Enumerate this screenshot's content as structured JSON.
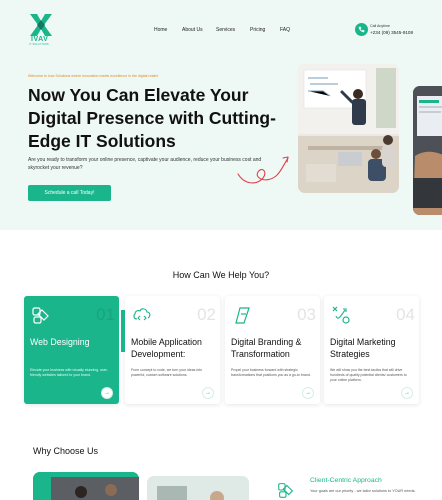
{
  "brand": {
    "name": "IVAV",
    "tagline": "IT SOLUTIONS",
    "accent": "#1bb58c",
    "hero_bg": "#eef8f5",
    "welcome_color": "#e08a1e"
  },
  "nav": {
    "items": [
      "Home",
      "About Us",
      "Services",
      "Pricing",
      "FAQ"
    ]
  },
  "contact": {
    "label": "Call Anytime",
    "phone": "+234 (09) 3545-9108",
    "icon": "phone-icon"
  },
  "hero": {
    "welcome": "Welcome to Ivav Solutions where innovation meets excellence in the digital realm!",
    "title": "Now You Can Elevate Your Digital Presence with Cutting-Edge IT Solutions",
    "description": "Are you ready to transform your online presence, captivate your audience, reduce your business cost and skyrocket your revenue?",
    "cta": "Schedule a call Today!"
  },
  "services": {
    "title": "How Can We Help You?",
    "cards": [
      {
        "num": "01",
        "title": "Web Designing",
        "desc": "Elevate your business with visually stunning, user-friendly websites tailored to your brand.",
        "icon": "design-tools-icon",
        "active": true
      },
      {
        "num": "02",
        "title": "Mobile Application Development:",
        "desc": "From concept to code, we turn your ideas into powerful, custom software solutions.",
        "icon": "cloud-code-icon",
        "active": false
      },
      {
        "num": "03",
        "title": "Digital Branding & Transformation",
        "desc": "Propel your business forward with strategic transformations that positions you as a go-to brand.",
        "icon": "brand-pen-icon",
        "active": false
      },
      {
        "num": "04",
        "title": "Digital Marketing Strategies",
        "desc": "We will show you the best tactics that will drive hundreds of quality potential clients/ customers to your online platform.",
        "icon": "strategy-icon",
        "active": false
      }
    ],
    "arrow": "→"
  },
  "why": {
    "title": "Why Choose Us",
    "feature_title": "Client-Centric Approach",
    "feature_text": "Your goals are our priority - we tailor solutions to YOUR needs."
  }
}
